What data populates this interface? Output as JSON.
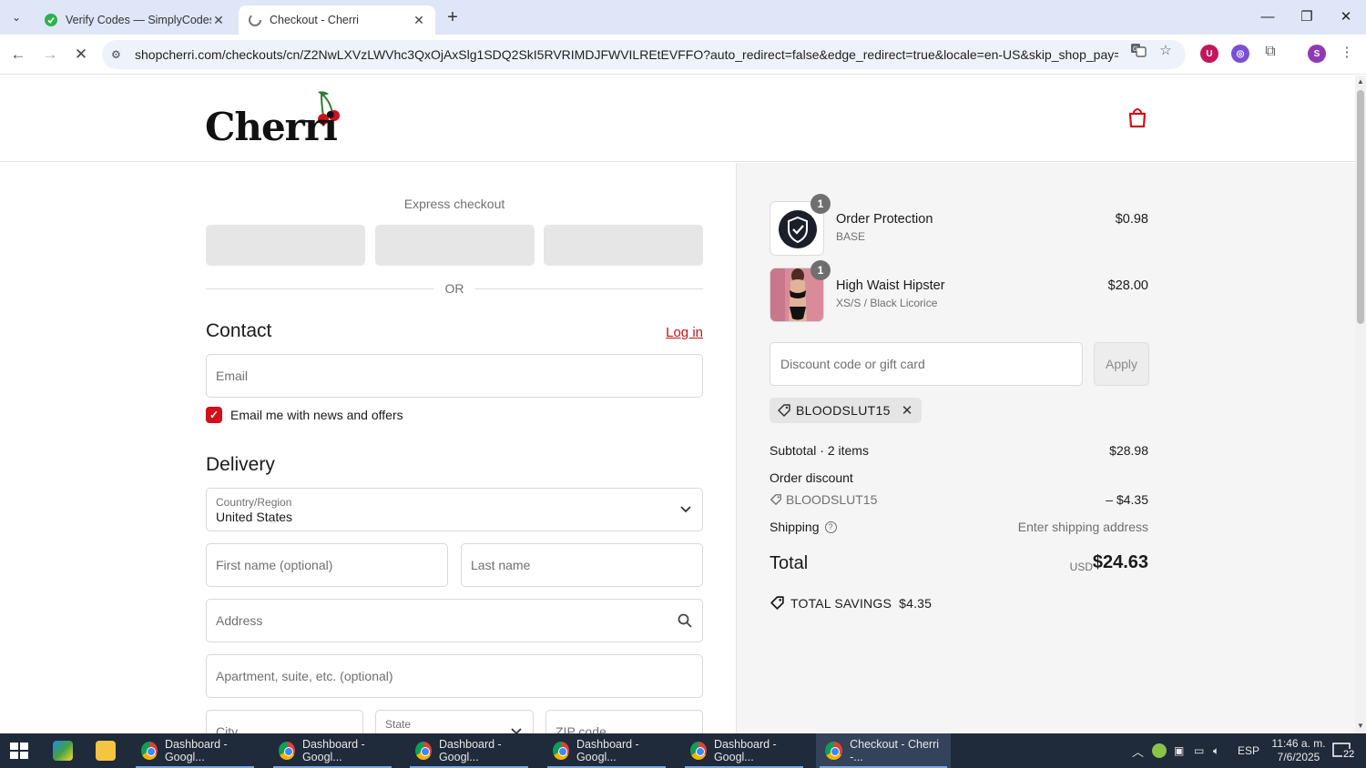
{
  "browser": {
    "tabs": [
      {
        "title": "Verify Codes — SimplyCodes",
        "icon": "simplycodes-icon"
      },
      {
        "title": "Checkout - Cherri",
        "icon": "loading-icon",
        "active": true
      }
    ],
    "url": "shopcherri.com/checkouts/cn/Z2NwLXVzLWVhc3QxOjAxSlg1SDQ2SkI5RVRIMDJFWVILREtEVFFO?auto_redirect=false&edge_redirect=true&locale=en-US&skip_shop_pay=true"
  },
  "site": {
    "logo_text": "Cherri"
  },
  "checkout": {
    "express_title": "Express checkout",
    "or_text": "OR",
    "contact_heading": "Contact",
    "login_label": "Log in",
    "email_placeholder": "Email",
    "newsletter_label": "Email me with news and offers",
    "newsletter_checked": true,
    "delivery_heading": "Delivery",
    "country_label": "Country/Region",
    "country_value": "United States",
    "first_name_placeholder": "First name (optional)",
    "last_name_placeholder": "Last name",
    "address_placeholder": "Address",
    "apartment_placeholder": "Apartment, suite, etc. (optional)",
    "city_placeholder": "City",
    "state_label": "State",
    "zip_placeholder": "ZIP code"
  },
  "summary": {
    "items": [
      {
        "name": "Order Protection",
        "variant": "BASE",
        "price": "$0.98",
        "qty": "1"
      },
      {
        "name": "High Waist Hipster",
        "variant": "XS/S / Black Licorice",
        "price": "$28.00",
        "qty": "1"
      }
    ],
    "discount_placeholder": "Discount code or gift card",
    "apply_label": "Apply",
    "applied_code": "BLOODSLUT15",
    "subtotal_label": "Subtotal · 2 items",
    "subtotal_value": "$28.98",
    "order_discount_label": "Order discount",
    "discount_code": "BLOODSLUT15",
    "discount_value": "– $4.35",
    "shipping_label": "Shipping",
    "shipping_value": "Enter shipping address",
    "total_label": "Total",
    "total_currency": "USD",
    "total_value": "$24.63",
    "savings_label": "TOTAL SAVINGS",
    "savings_value": "$4.35"
  },
  "taskbar": {
    "items": [
      {
        "label": "Dashboard - Googl..."
      },
      {
        "label": "Dashboard - Googl..."
      },
      {
        "label": "Dashboard - Googl..."
      },
      {
        "label": "Dashboard - Googl..."
      },
      {
        "label": "Dashboard - Googl..."
      },
      {
        "label": "Checkout - Cherri -..."
      }
    ],
    "language": "ESP",
    "time": "11:46 a. m.",
    "date": "7/6/2025",
    "notifications": "22"
  },
  "colors": {
    "accent": "#c4121a",
    "checkbox": "#d0101a",
    "tabbar": "#dfe6f7",
    "taskbar": "#1f2a3a"
  }
}
